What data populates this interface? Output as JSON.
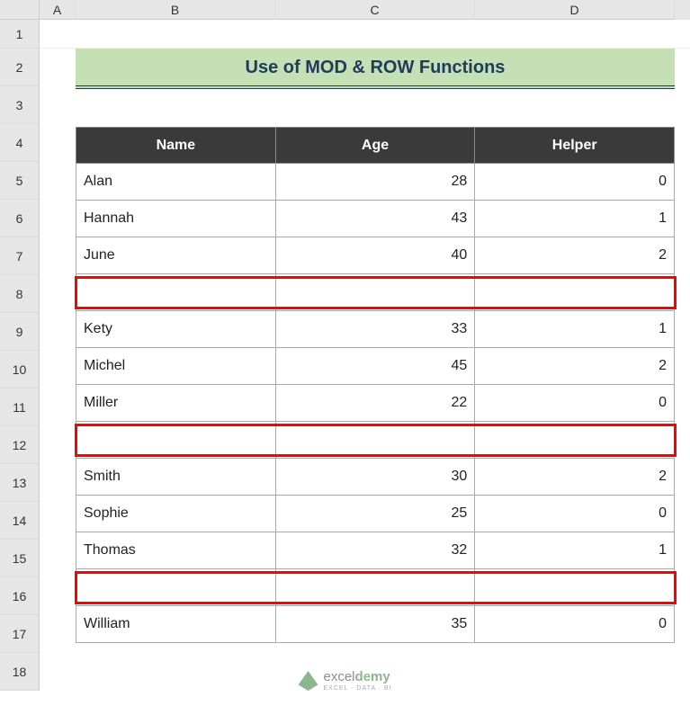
{
  "columns": [
    "A",
    "B",
    "C",
    "D"
  ],
  "row_numbers": [
    "1",
    "2",
    "3",
    "4",
    "5",
    "6",
    "7",
    "8",
    "9",
    "10",
    "11",
    "12",
    "13",
    "14",
    "15",
    "16",
    "17",
    "18"
  ],
  "title": "Use of MOD & ROW Functions",
  "headers": {
    "name": "Name",
    "age": "Age",
    "helper": "Helper"
  },
  "rows": [
    {
      "name": "Alan",
      "age": "28",
      "helper": "0",
      "highlight": false
    },
    {
      "name": "Hannah",
      "age": "43",
      "helper": "1",
      "highlight": false
    },
    {
      "name": "June",
      "age": "40",
      "helper": "2",
      "highlight": false
    },
    {
      "name": "",
      "age": "",
      "helper": "",
      "highlight": true
    },
    {
      "name": "Kety",
      "age": "33",
      "helper": "1",
      "highlight": false
    },
    {
      "name": "Michel",
      "age": "45",
      "helper": "2",
      "highlight": false
    },
    {
      "name": "Miller",
      "age": "22",
      "helper": "0",
      "highlight": false
    },
    {
      "name": "",
      "age": "",
      "helper": "",
      "highlight": true
    },
    {
      "name": "Smith",
      "age": "30",
      "helper": "2",
      "highlight": false
    },
    {
      "name": "Sophie",
      "age": "25",
      "helper": "0",
      "highlight": false
    },
    {
      "name": "Thomas",
      "age": "32",
      "helper": "1",
      "highlight": false
    },
    {
      "name": "",
      "age": "",
      "helper": "",
      "highlight": true
    },
    {
      "name": "William",
      "age": "35",
      "helper": "0",
      "highlight": false
    }
  ],
  "watermark": {
    "brand1": "excel",
    "brand2": "demy",
    "tagline": "EXCEL · DATA · BI"
  }
}
